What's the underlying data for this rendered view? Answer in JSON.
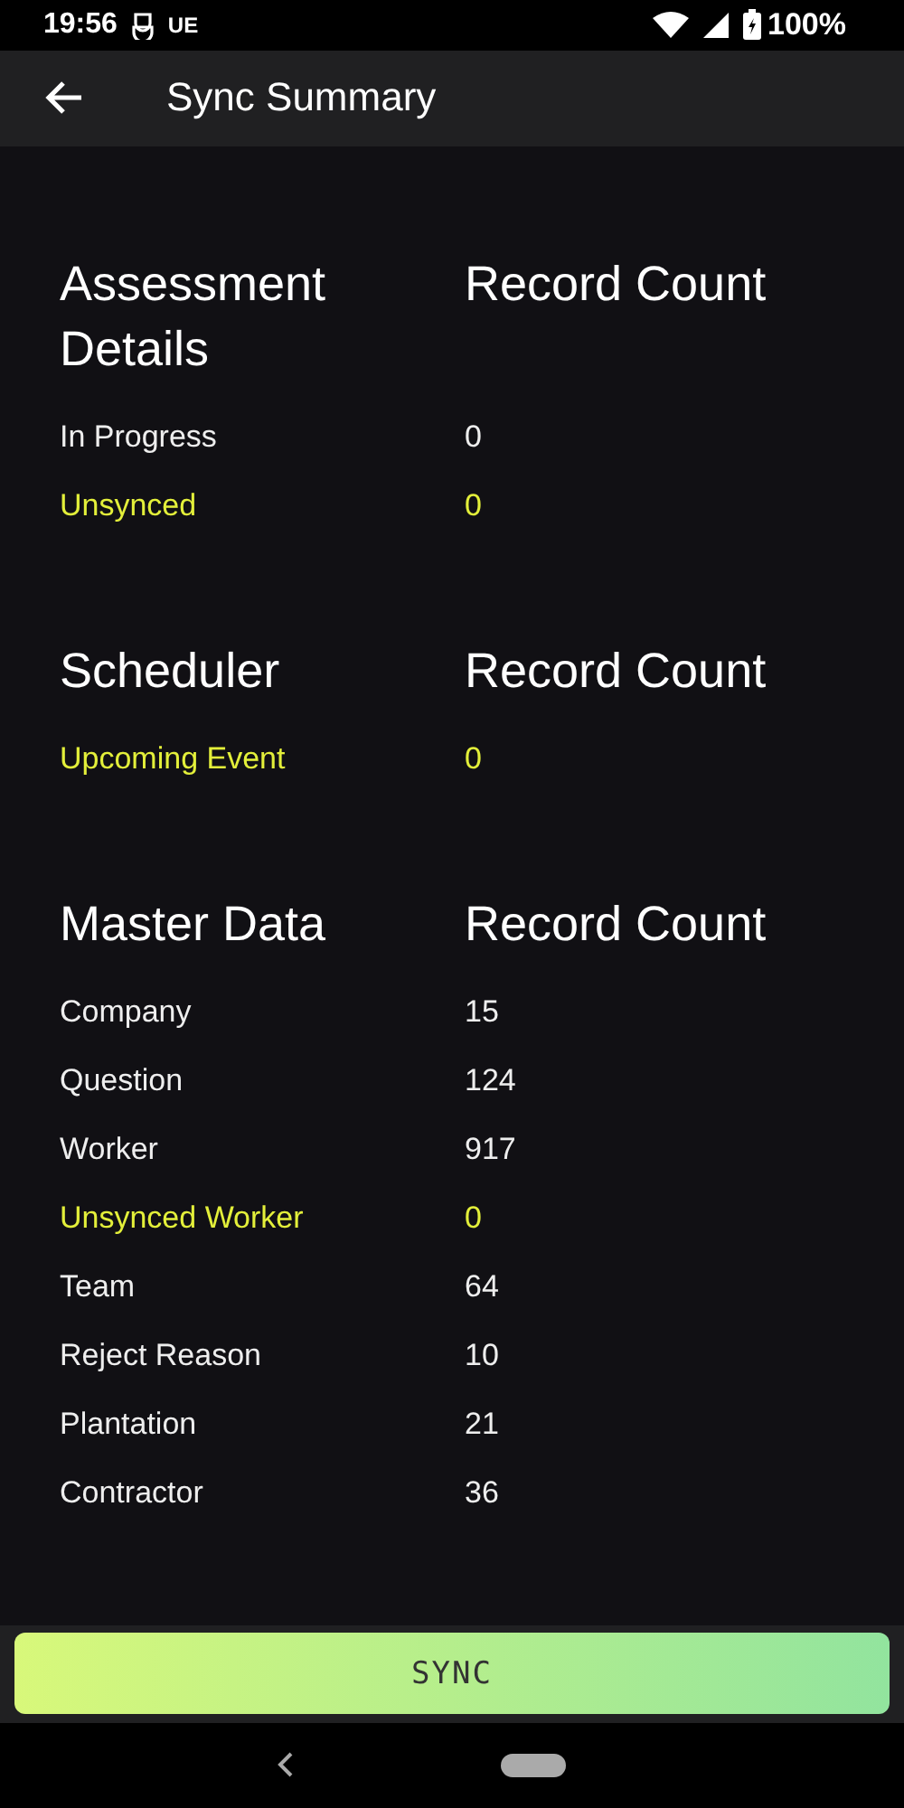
{
  "status_bar": {
    "time": "19:56",
    "carrier": "UE",
    "battery": "100%"
  },
  "app_bar": {
    "title": "Sync Summary"
  },
  "sections": [
    {
      "title": "Assessment Details",
      "count_heading": "Record Count",
      "rows": [
        {
          "label": "In Progress",
          "value": "0",
          "highlighted": false
        },
        {
          "label": "Unsynced",
          "value": "0",
          "highlighted": true
        }
      ]
    },
    {
      "title": "Scheduler",
      "count_heading": "Record Count",
      "rows": [
        {
          "label": "Upcoming Event",
          "value": "0",
          "highlighted": true
        }
      ]
    },
    {
      "title": "Master Data",
      "count_heading": "Record Count",
      "rows": [
        {
          "label": "Company",
          "value": "15",
          "highlighted": false
        },
        {
          "label": "Question",
          "value": "124",
          "highlighted": false
        },
        {
          "label": "Worker",
          "value": "917",
          "highlighted": false
        },
        {
          "label": "Unsynced Worker",
          "value": "0",
          "highlighted": true
        },
        {
          "label": "Team",
          "value": "64",
          "highlighted": false
        },
        {
          "label": "Reject Reason",
          "value": "10",
          "highlighted": false
        },
        {
          "label": "Plantation",
          "value": "21",
          "highlighted": false
        },
        {
          "label": "Contractor",
          "value": "36",
          "highlighted": false
        }
      ]
    }
  ],
  "sync_button": "SYNC"
}
